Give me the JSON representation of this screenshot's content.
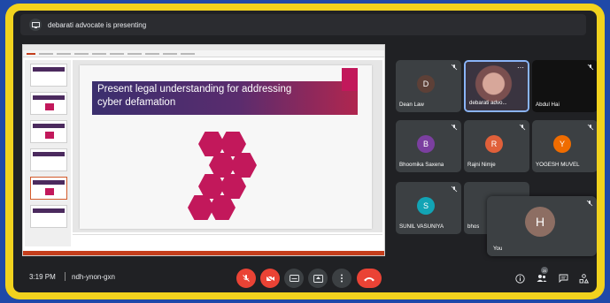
{
  "presenter": {
    "text": "debarati advocate is presenting"
  },
  "slide": {
    "title": "Present legal understanding for addressing cyber defamation"
  },
  "participants": [
    {
      "name": "Dean Law",
      "initial": "D",
      "color": "#5d4037"
    },
    {
      "name": "debarati advo...",
      "initial": "",
      "color": ""
    },
    {
      "name": "Abdul Hai",
      "initial": "",
      "color": ""
    },
    {
      "name": "Bhoomika Saxena",
      "initial": "B",
      "color": "#7b3fa0"
    },
    {
      "name": "Rajni Nimje",
      "initial": "R",
      "color": "#e0603a"
    },
    {
      "name": "YOGESH MUVEL",
      "initial": "Y",
      "color": "#ef6c00"
    },
    {
      "name": "SUNIL VASUNIYA",
      "initial": "S",
      "color": "#12a4b5"
    },
    {
      "name": "bhos",
      "initial": "",
      "color": ""
    }
  ],
  "self": {
    "name": "You",
    "initial": "H",
    "color": "#8d6e63"
  },
  "bottom": {
    "time": "3:19 PM",
    "meeting_code": "ndh-ynon-gxn",
    "people_count": "20"
  }
}
